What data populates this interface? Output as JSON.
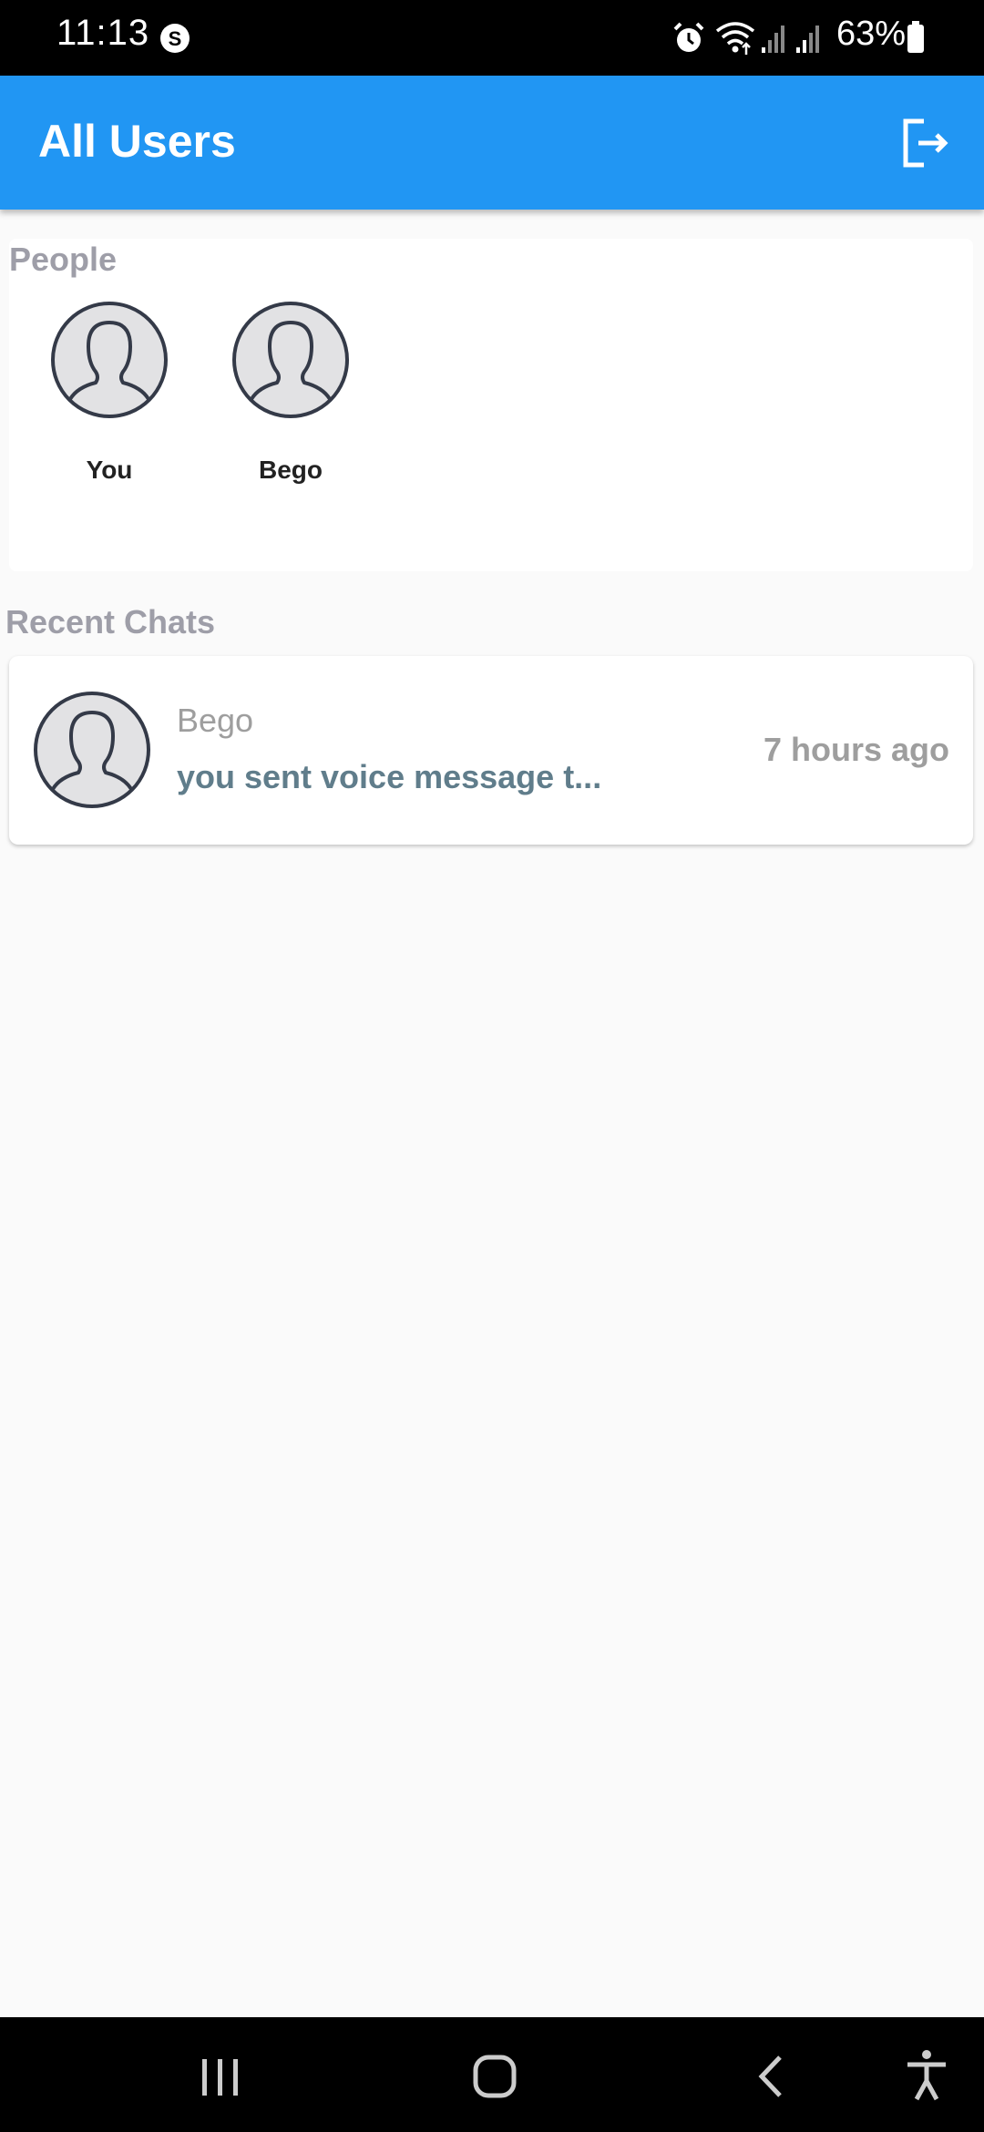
{
  "status_bar": {
    "time": "11:13",
    "battery": "63%",
    "icons": [
      "s-icon",
      "alarm-icon",
      "wifi-icon",
      "signal-icon",
      "signal-icon",
      "battery-icon"
    ]
  },
  "app_bar": {
    "title": "All Users",
    "logout_icon": "logout-icon"
  },
  "people": {
    "heading": "People",
    "items": [
      {
        "name": "You",
        "avatar": "person-avatar-icon"
      },
      {
        "name": "Bego",
        "avatar": "person-avatar-icon"
      }
    ]
  },
  "recent_chats": {
    "heading": "Recent Chats",
    "items": [
      {
        "name": "Bego",
        "preview": "you sent voice message t...",
        "time": "7 hours ago",
        "avatar": "person-avatar-icon"
      }
    ]
  },
  "nav_bar": {
    "icons": [
      "recents-icon",
      "home-icon",
      "back-icon",
      "accessibility-icon"
    ]
  },
  "colors": {
    "app_bar": "#2196f3",
    "heading": "#9e9ea8",
    "preview": "#607d8b",
    "time": "#9e9e9e"
  }
}
